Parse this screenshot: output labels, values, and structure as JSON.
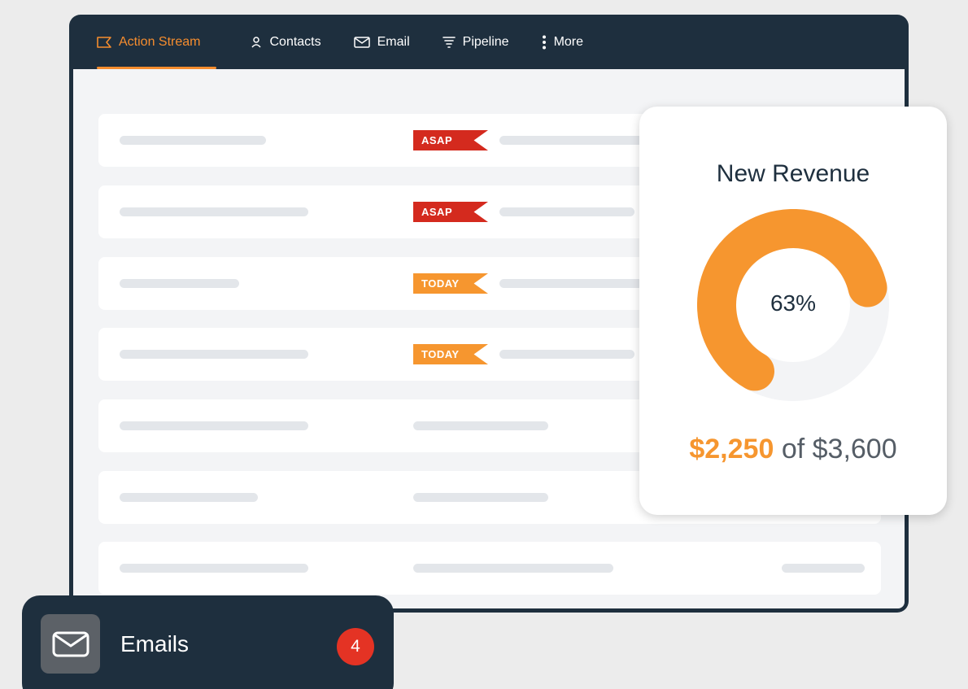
{
  "nav": {
    "items": [
      {
        "label": "Action Stream",
        "icon": "flag-icon",
        "active": true
      },
      {
        "label": "Contacts",
        "icon": "person-icon",
        "active": false
      },
      {
        "label": "Email",
        "icon": "envelope-icon",
        "active": false
      },
      {
        "label": "Pipeline",
        "icon": "funnel-icon",
        "active": false
      },
      {
        "label": "More",
        "icon": "kebab-icon",
        "active": false
      }
    ]
  },
  "tasks": {
    "flags": [
      "ASAP",
      "ASAP",
      "TODAY",
      "TODAY"
    ]
  },
  "revenue": {
    "title": "New Revenue",
    "percent_label": "63%",
    "percent_value": 0.63,
    "current": "$2,250",
    "of_text": "of",
    "total": "$3,600"
  },
  "emails": {
    "label": "Emails",
    "count": "4",
    "icon": "envelope-icon"
  },
  "colors": {
    "navy": "#1e2f3e",
    "accent_orange": "#f6962f",
    "asap_red": "#d42a1e",
    "badge_red": "#e43324"
  }
}
